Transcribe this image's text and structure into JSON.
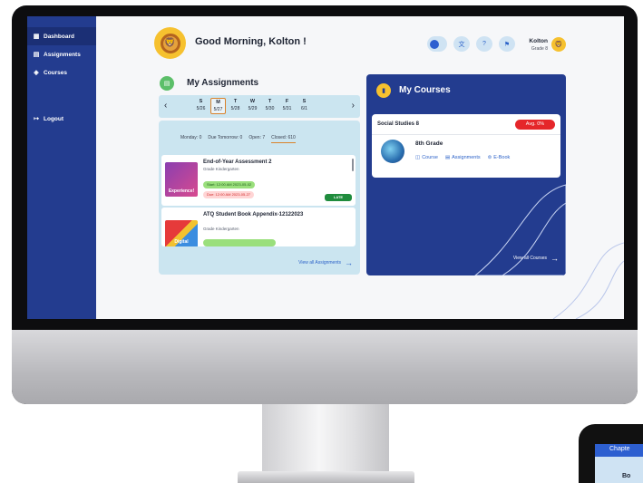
{
  "sidebar": {
    "items": [
      {
        "label": "Dashboard",
        "icon": "dashboard-icon",
        "glyph": "▦"
      },
      {
        "label": "Assignments",
        "icon": "assignments-icon",
        "glyph": "▤"
      },
      {
        "label": "Courses",
        "icon": "courses-icon",
        "glyph": "◈"
      }
    ],
    "logout": {
      "label": "Logout",
      "glyph": "↦"
    }
  },
  "header": {
    "greeting": "Good Morning, Kolton !",
    "user_name": "Kolton",
    "user_grade": "Grade 8"
  },
  "assignments": {
    "title": "My Assignments",
    "week": [
      {
        "letter": "S",
        "date": "5/26"
      },
      {
        "letter": "M",
        "date": "5/27"
      },
      {
        "letter": "T",
        "date": "5/28"
      },
      {
        "letter": "W",
        "date": "5/29"
      },
      {
        "letter": "T",
        "date": "5/30"
      },
      {
        "letter": "F",
        "date": "5/31"
      },
      {
        "letter": "S",
        "date": "6/1"
      }
    ],
    "filters": [
      "Monday: 0",
      "Due Tomorrow: 0",
      "Open: 7",
      "Closed: 610"
    ],
    "items": [
      {
        "title": "End-of-Year Assessment 2",
        "subtitle": "Grade Kindergarten",
        "start": "Start: 12:00 AM 2023-05-02",
        "due": "Due: 12:00 AM 2023-05-27",
        "status": "LATE",
        "thumb_text": "Experience!"
      },
      {
        "title": "ATQ Student Book Appendix-12122023",
        "subtitle": "Grade Kindergarten",
        "thumb_text": "Digital"
      }
    ],
    "view_all": "View all Assignments"
  },
  "courses": {
    "title": "My Courses",
    "items": [
      {
        "name": "Social Studies 8",
        "avg": "Avg. 0%",
        "grade": "8th Grade",
        "links": [
          "Course",
          "Assignments",
          "E-Book"
        ]
      }
    ],
    "view_all": "View all Courses"
  },
  "peek": {
    "head": "Chapte",
    "body": "Bo"
  },
  "colors": {
    "sidebar": "#233c8f",
    "panel_light": "#cbe5f0",
    "accent_orange": "#d9822b",
    "late_green": "#1f8c3d",
    "avg_red": "#e5262a"
  }
}
